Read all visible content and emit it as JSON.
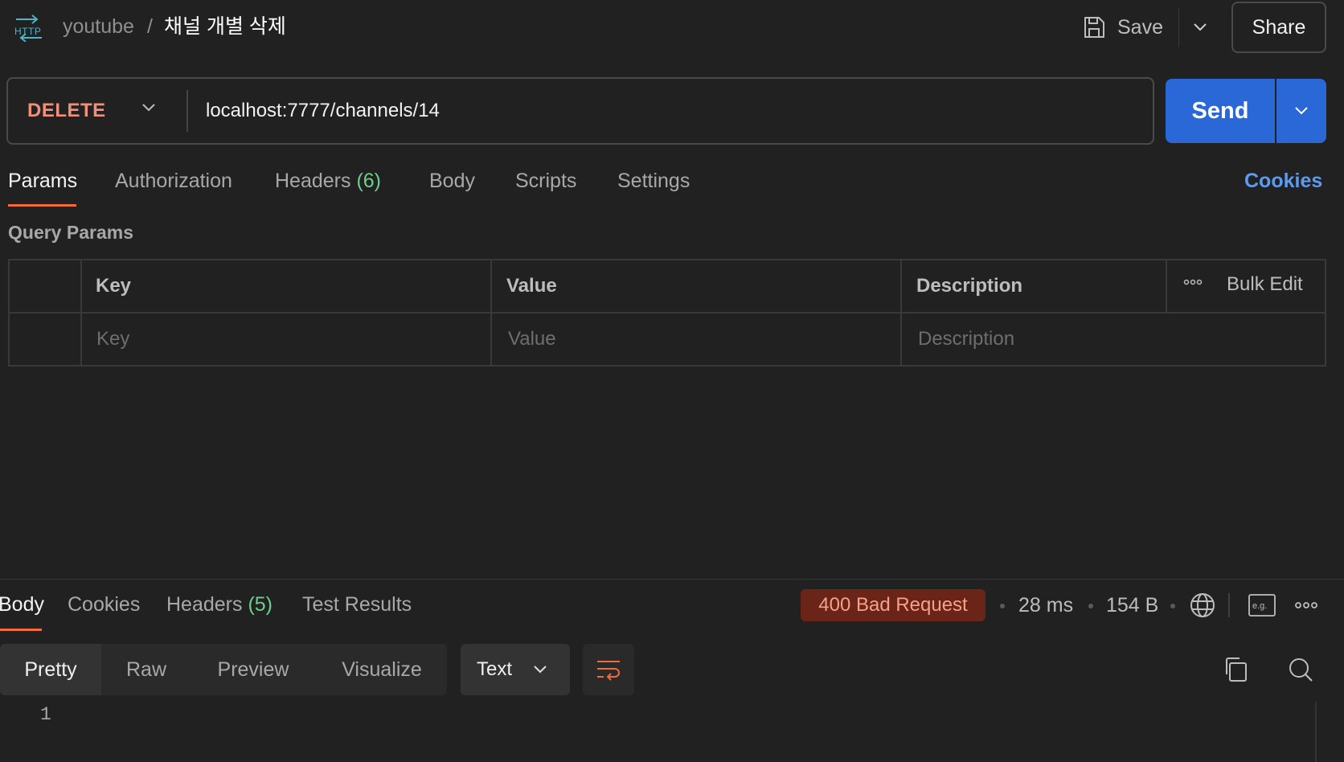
{
  "header": {
    "request_type_icon": "http-icon",
    "collection": "youtube",
    "separator": "/",
    "request_name": "채널 개별 삭제",
    "save_label": "Save",
    "share_label": "Share"
  },
  "request": {
    "method": "DELETE",
    "url": "localhost:7777/channels/14",
    "send_label": "Send"
  },
  "request_tabs": {
    "params": "Params",
    "authorization": "Authorization",
    "headers": "Headers",
    "headers_count": "(6)",
    "body": "Body",
    "scripts": "Scripts",
    "settings": "Settings",
    "cookies": "Cookies"
  },
  "query_params": {
    "title": "Query Params",
    "columns": {
      "key": "Key",
      "value": "Value",
      "description": "Description"
    },
    "bulk_edit": "Bulk Edit",
    "placeholders": {
      "key": "Key",
      "value": "Value",
      "description": "Description"
    }
  },
  "response": {
    "tabs": {
      "body": "Body",
      "cookies": "Cookies",
      "headers": "Headers",
      "headers_count": "(5)",
      "test_results": "Test Results"
    },
    "status": "400 Bad Request",
    "time": "28 ms",
    "size": "154 B",
    "view_modes": [
      "Pretty",
      "Raw",
      "Preview",
      "Visualize"
    ],
    "format": "Text",
    "line_numbers": [
      "1"
    ]
  },
  "colors": {
    "background": "#212121",
    "accent_orange": "#f26b3a",
    "method_delete": "#f0907b",
    "send_blue": "#2968d6",
    "cookies_link": "#5b9bf0",
    "count_green": "#6fcf8a",
    "status_error_bg": "#6b2418",
    "status_error_fg": "#f4a08a"
  }
}
